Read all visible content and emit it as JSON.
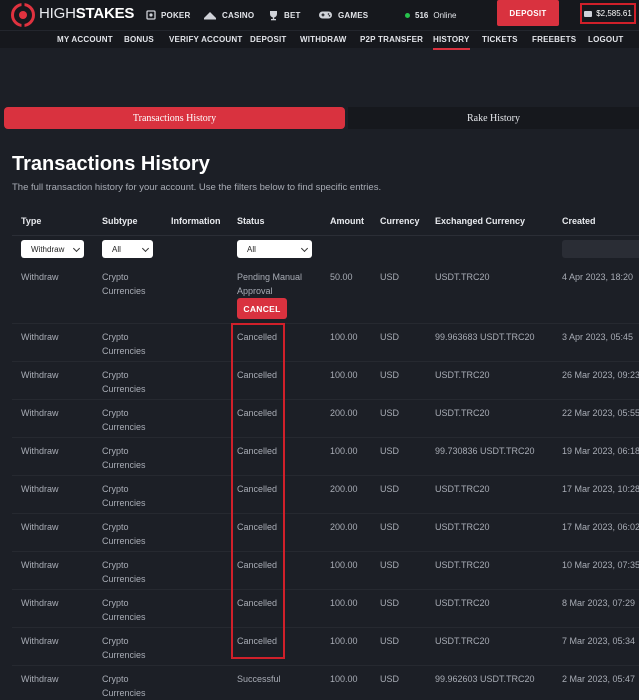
{
  "brand": {
    "high": "HIGH",
    "stakes": "STAKES",
    "accent": "#d9323f"
  },
  "nav": [
    {
      "label": "POKER",
      "icon": "poker-chip-icon"
    },
    {
      "label": "CASINO",
      "icon": "casino-icon"
    },
    {
      "label": "BET",
      "icon": "trophy-icon"
    },
    {
      "label": "GAMES",
      "icon": "gamepad-icon"
    }
  ],
  "online": {
    "count": "516",
    "label": "Online"
  },
  "deposit_label": "DEPOSIT",
  "balance": "$2,585.61",
  "subnav": [
    "MY ACCOUNT",
    "BONUS",
    "VERIFY ACCOUNT",
    "DEPOSIT",
    "WITHDRAW",
    "P2P TRANSFER",
    "HISTORY",
    "TICKETS",
    "FREEBETS",
    "LOGOUT"
  ],
  "tabs": {
    "active": "Transactions History",
    "inactive": "Rake History"
  },
  "page": {
    "title": "Transactions History",
    "subtitle": "The full transaction history for your account. Use the filters below to find specific entries."
  },
  "table": {
    "headers": [
      "Type",
      "Subtype",
      "Information",
      "Status",
      "Amount",
      "Currency",
      "Exchanged Currency",
      "Created"
    ],
    "filters": {
      "type": "Withdraw",
      "subtype": "All",
      "status": "All"
    },
    "cancel_label": "CANCEL",
    "rows": [
      {
        "type": "Withdraw",
        "subtype": "Crypto Currencies",
        "status": "Pending Manual Approval",
        "amount": "50.00",
        "currency": "USD",
        "exchanged": "USDT.TRC20",
        "created": "4 Apr 2023, 18:20"
      },
      {
        "type": "Withdraw",
        "subtype": "Crypto Currencies",
        "status": "Cancelled",
        "amount": "100.00",
        "currency": "USD",
        "exchanged": "99.963683 USDT.TRC20",
        "created": "3 Apr 2023, 05:45"
      },
      {
        "type": "Withdraw",
        "subtype": "Crypto Currencies",
        "status": "Cancelled",
        "amount": "100.00",
        "currency": "USD",
        "exchanged": "USDT.TRC20",
        "created": "26 Mar 2023, 09:23"
      },
      {
        "type": "Withdraw",
        "subtype": "Crypto Currencies",
        "status": "Cancelled",
        "amount": "200.00",
        "currency": "USD",
        "exchanged": "USDT.TRC20",
        "created": "22 Mar 2023, 05:55"
      },
      {
        "type": "Withdraw",
        "subtype": "Crypto Currencies",
        "status": "Cancelled",
        "amount": "100.00",
        "currency": "USD",
        "exchanged": "99.730836 USDT.TRC20",
        "created": "19 Mar 2023, 06:18"
      },
      {
        "type": "Withdraw",
        "subtype": "Crypto Currencies",
        "status": "Cancelled",
        "amount": "200.00",
        "currency": "USD",
        "exchanged": "USDT.TRC20",
        "created": "17 Mar 2023, 10:28"
      },
      {
        "type": "Withdraw",
        "subtype": "Crypto Currencies",
        "status": "Cancelled",
        "amount": "200.00",
        "currency": "USD",
        "exchanged": "USDT.TRC20",
        "created": "17 Mar 2023, 06:02"
      },
      {
        "type": "Withdraw",
        "subtype": "Crypto Currencies",
        "status": "Cancelled",
        "amount": "100.00",
        "currency": "USD",
        "exchanged": "USDT.TRC20",
        "created": "10 Mar 2023, 07:35"
      },
      {
        "type": "Withdraw",
        "subtype": "Crypto Currencies",
        "status": "Cancelled",
        "amount": "100.00",
        "currency": "USD",
        "exchanged": "USDT.TRC20",
        "created": "8 Mar 2023, 07:29"
      },
      {
        "type": "Withdraw",
        "subtype": "Crypto Currencies",
        "status": "Cancelled",
        "amount": "100.00",
        "currency": "USD",
        "exchanged": "USDT.TRC20",
        "created": "7 Mar 2023, 05:34"
      },
      {
        "type": "Withdraw",
        "subtype": "Crypto Currencies",
        "status": "Successful",
        "amount": "100.00",
        "currency": "USD",
        "exchanged": "99.962603 USDT.TRC20",
        "created": "2 Mar 2023, 05:47"
      }
    ]
  }
}
